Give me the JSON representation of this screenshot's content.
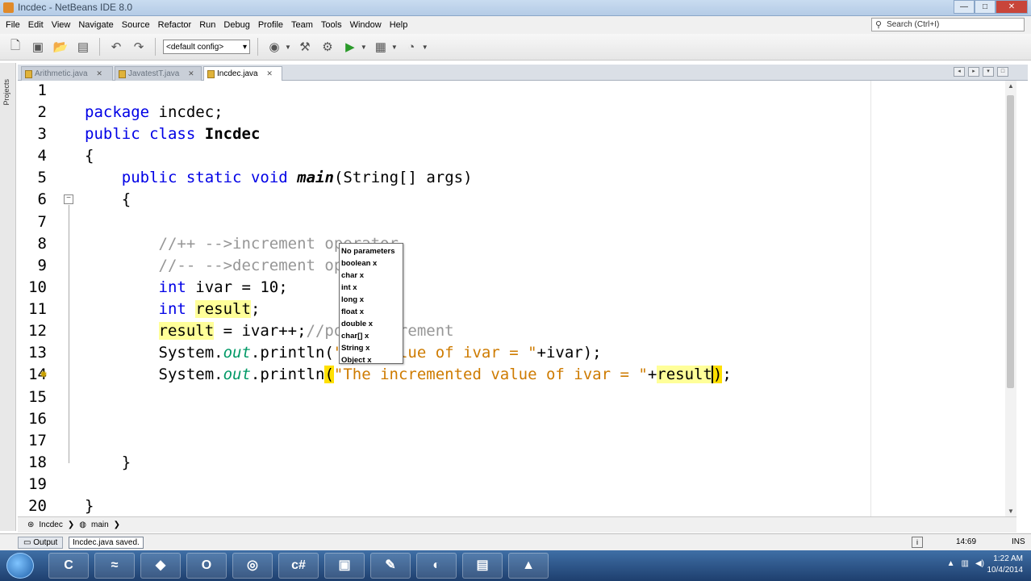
{
  "window": {
    "title": "Incdec - NetBeans IDE 8.0"
  },
  "menu": [
    "File",
    "Edit",
    "View",
    "Navigate",
    "Source",
    "Refactor",
    "Run",
    "Debug",
    "Profile",
    "Team",
    "Tools",
    "Window",
    "Help"
  ],
  "search": {
    "placeholder": "Search (Ctrl+I)"
  },
  "toolbar": {
    "config": "<default config>"
  },
  "sidebar": {
    "projects_label": "Projects"
  },
  "tabs": [
    {
      "label": "Arithmetic.java",
      "active": false
    },
    {
      "label": "JavatestT.java",
      "active": false
    },
    {
      "label": "Incdec.java",
      "active": true
    }
  ],
  "editor": {
    "line_numbers": [
      "1",
      "2",
      "3",
      "4",
      "5",
      "6",
      "7",
      "8",
      "9",
      "10",
      "11",
      "12",
      "13",
      "14",
      "15",
      "16",
      "17",
      "18",
      "19",
      "20"
    ],
    "lines": [
      "",
      "package incdec;",
      "public class Incdec",
      "{",
      "    public static void main(String[] args)",
      "    {",
      "",
      "        //++ -->increment operator",
      "        //-- -->decrement operator",
      "        int ivar = 10;",
      "        int result;",
      "        result = ivar++;//post increment",
      "        System.out.println(\"The value of ivar = \"+ivar);",
      "        System.out.println(\"The incremented value of ivar = \"+result);",
      "",
      "",
      "",
      "    }",
      "",
      "}"
    ]
  },
  "completion": {
    "items": [
      "No parameters",
      "boolean x",
      "char x",
      "int x",
      "long x",
      "float x",
      "double x",
      "char[] x",
      "String x",
      "Object x"
    ]
  },
  "breadcrumb": {
    "class": "Incdec",
    "method": "main"
  },
  "status": {
    "output_label": "Output",
    "message": "Incdec.java saved.",
    "position": "14:69",
    "mode": "INS"
  },
  "taskbar": {
    "time": "1:22 AM",
    "date": "10/4/2014"
  }
}
